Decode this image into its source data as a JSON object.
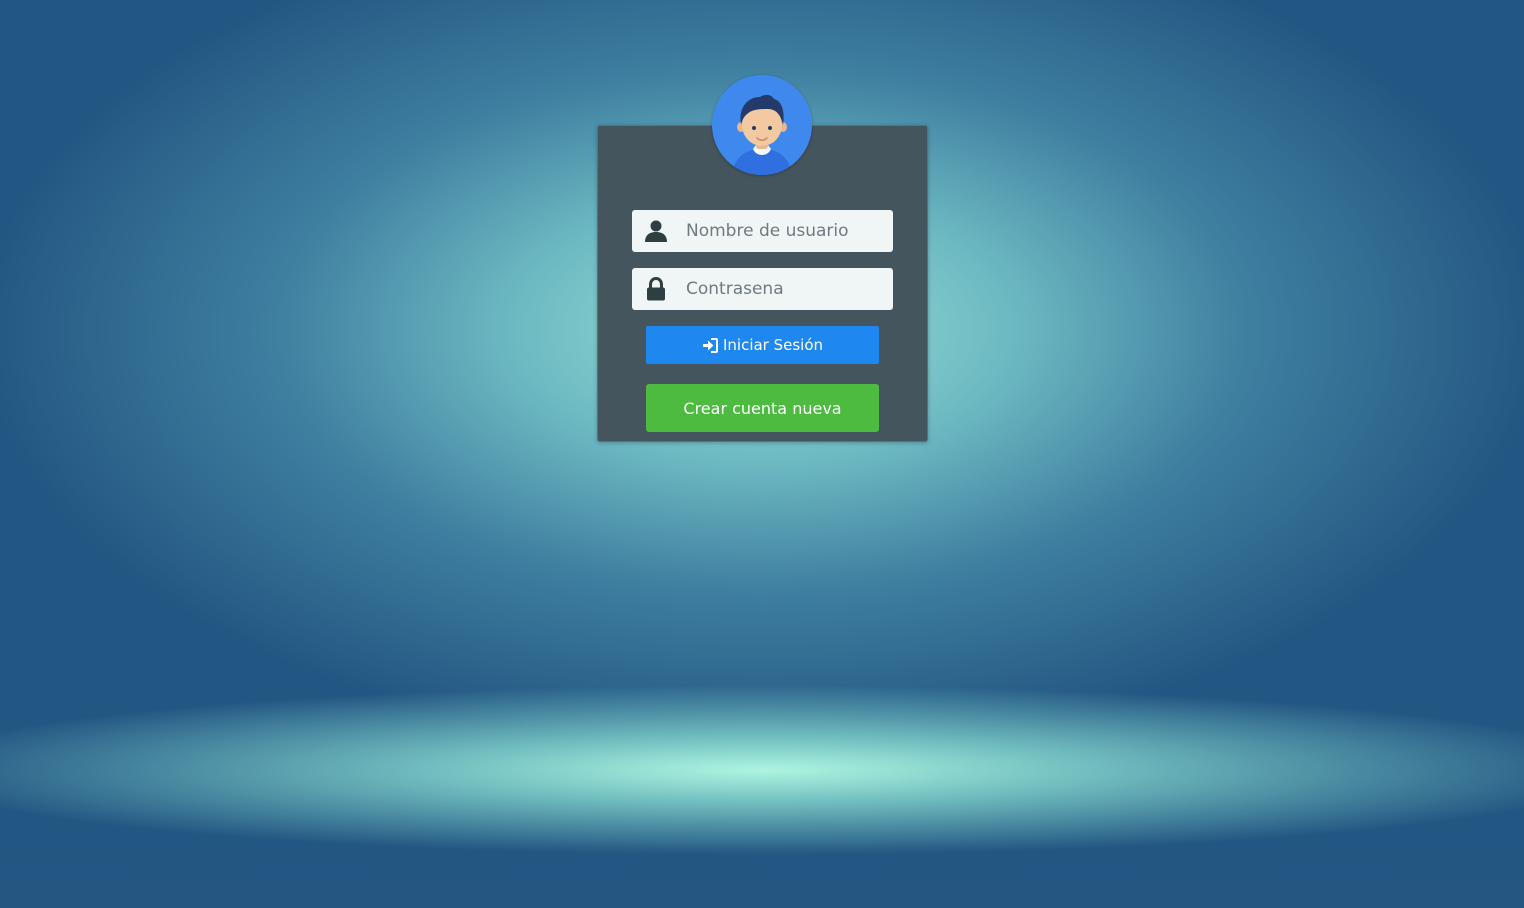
{
  "login": {
    "username_placeholder": "Nombre de usuario",
    "username_value": "",
    "password_placeholder": "Contrasena",
    "password_value": "",
    "submit_label": "Iniciar Sesión",
    "create_account_label": "Crear cuenta nueva"
  },
  "icons": {
    "avatar": "user-avatar-icon",
    "username": "user-icon",
    "password": "lock-icon",
    "submit": "sign-in-icon"
  },
  "colors": {
    "card_background": "#45555e",
    "login_button": "#1e88f0",
    "create_button": "#4cbb40",
    "avatar_background": "#3f88ee",
    "icon_color": "#2f3e43"
  }
}
